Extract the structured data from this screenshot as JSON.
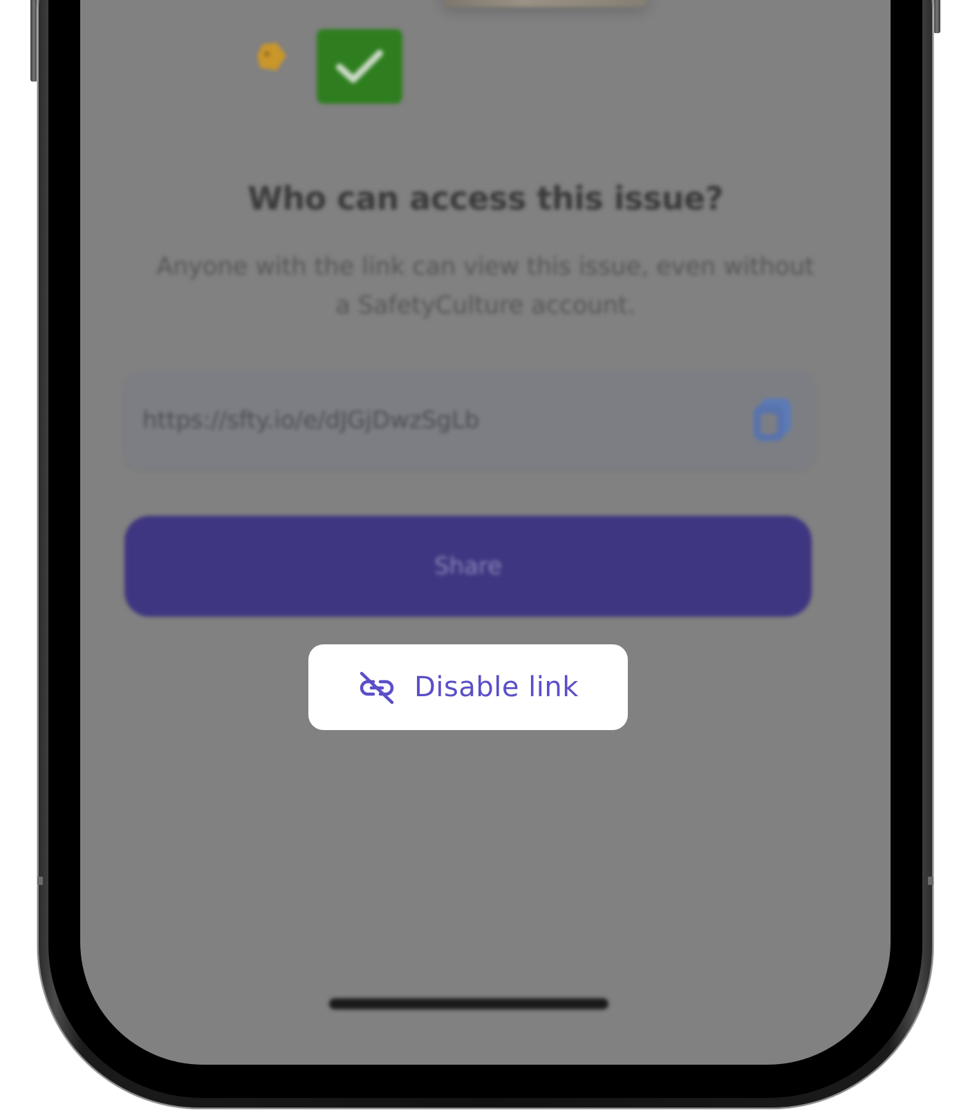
{
  "access_sheet": {
    "heading": "Who can access this issue?",
    "description": "Anyone with the link can view this issue, even without a SafetyCulture account.",
    "link_url": "https://sfty.io/e/dJGjDwzSgLb",
    "share_label": "Share",
    "disable_link_label": "Disable link"
  },
  "icons": {
    "tag": "tag-icon",
    "check": "check-icon",
    "copy": "copy-icon",
    "unlink": "unlink-icon"
  },
  "colors": {
    "overlay": "#818181",
    "share_button": "#3e3680",
    "accent": "#5a4fc8",
    "check_tile": "#2e7e1f",
    "tag": "#c9962a"
  }
}
